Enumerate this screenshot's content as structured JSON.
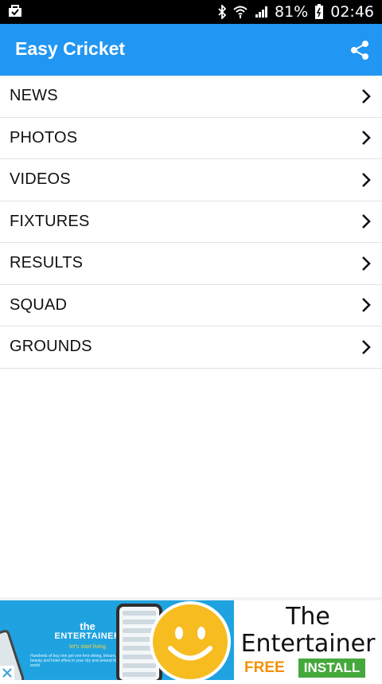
{
  "status_bar": {
    "battery_percent": "81%",
    "time": "02:46",
    "icons": [
      "notification-icon",
      "bluetooth-icon",
      "wifi-icon",
      "signal-icon",
      "battery-icon"
    ]
  },
  "app_bar": {
    "title": "Easy Cricket",
    "share_icon": "share-icon",
    "color": "#2196f3"
  },
  "menu": {
    "items": [
      {
        "label": "NEWS"
      },
      {
        "label": "PHOTOS"
      },
      {
        "label": "VIDEOS"
      },
      {
        "label": "FIXTURES"
      },
      {
        "label": "RESULTS"
      },
      {
        "label": "SQUAD"
      },
      {
        "label": "GROUNDS"
      }
    ],
    "chevron_icon": "chevron-right-icon"
  },
  "ad": {
    "brand_prefix": "the",
    "brand_name": "ENTERTAINER",
    "tagline": "let's start living",
    "blurb": "Hundreds of buy one get one free dining, leisure, beauty and hotel offers in your city and around the world",
    "title_line1": "The",
    "title_line2": "Entertainer",
    "price": "FREE",
    "cta": "INSTALL",
    "close_icon": "close-icon",
    "colors": {
      "banner": "#1fa3e0",
      "free": "#f29100",
      "install": "#45a83c",
      "smiley": "#f7bc1f"
    }
  }
}
